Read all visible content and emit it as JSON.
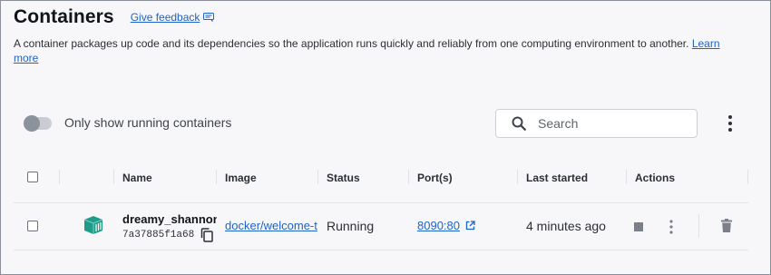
{
  "header": {
    "title": "Containers",
    "feedback_label": "Give feedback",
    "description": "A container packages up code and its dependencies so the application runs quickly and reliably from one computing environment to another.",
    "learn_more_label": "Learn more"
  },
  "toolbar": {
    "toggle_label": "Only show running containers",
    "toggle_on": false,
    "search_placeholder": "Search",
    "search_value": ""
  },
  "table": {
    "columns": [
      "Name",
      "Image",
      "Status",
      "Port(s)",
      "Last started",
      "Actions"
    ],
    "rows": [
      {
        "name": "dreamy_shannon",
        "id": "7a37885f1a68",
        "image": "docker/welcome-to-docker",
        "status": "Running",
        "port": "8090:80",
        "last_started": "4 minutes ago"
      }
    ]
  },
  "colors": {
    "accent": "#1d63c8",
    "container_icon": "#1f9b8a",
    "background": "#f7f7f9"
  },
  "icons": [
    "feedback-icon",
    "search-icon",
    "more-vert-icon",
    "container-icon",
    "copy-icon",
    "external-link-icon",
    "stop-icon",
    "trash-icon"
  ]
}
